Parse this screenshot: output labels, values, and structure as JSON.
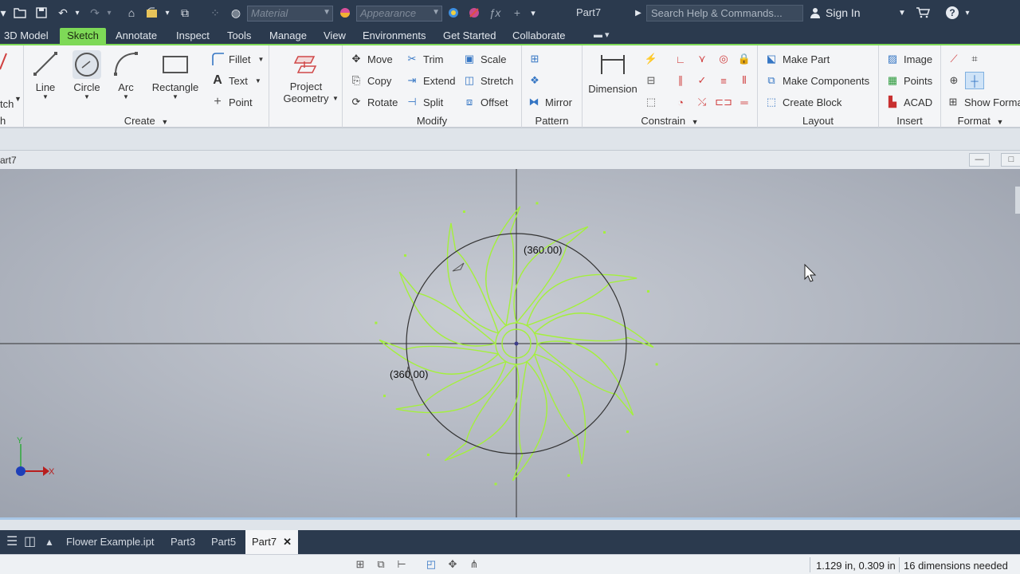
{
  "titlebar": {
    "material_placeholder": "Material",
    "appearance_placeholder": "Appearance",
    "document_title": "Part7",
    "search_placeholder": "Search Help & Commands...",
    "sign_in": "Sign In"
  },
  "tabs": [
    {
      "label": "3D Model"
    },
    {
      "label": "Sketch"
    },
    {
      "label": "Annotate"
    },
    {
      "label": "Inspect"
    },
    {
      "label": "Tools"
    },
    {
      "label": "Manage"
    },
    {
      "label": "View"
    },
    {
      "label": "Environments"
    },
    {
      "label": "Get Started"
    },
    {
      "label": "Collaborate"
    }
  ],
  "ribbon": {
    "cut_panel_label": "tch",
    "cut_panel_title": "h",
    "create": {
      "title": "Create",
      "line": "Line",
      "circle": "Circle",
      "arc": "Arc",
      "rectangle": "Rectangle",
      "fillet": "Fillet",
      "text": "Text",
      "point": "Point"
    },
    "project": {
      "line1": "Project",
      "line2": "Geometry"
    },
    "modify": {
      "title": "Modify",
      "move": "Move",
      "copy": "Copy",
      "rotate": "Rotate",
      "trim": "Trim",
      "extend": "Extend",
      "split": "Split",
      "scale": "Scale",
      "stretch": "Stretch",
      "offset": "Offset"
    },
    "pattern": {
      "title": "Pattern",
      "mirror": "Mirror"
    },
    "constrain": {
      "title": "Constrain",
      "dimension": "Dimension"
    },
    "layout": {
      "title": "Layout",
      "make_part": "Make Part",
      "make_components": "Make Components",
      "create_block": "Create Block"
    },
    "insert": {
      "title": "Insert",
      "image": "Image",
      "points": "Points",
      "acad": "ACAD"
    },
    "format": {
      "title": "Format",
      "show_format": "Show Format"
    }
  },
  "document": {
    "name": "art7"
  },
  "canvas": {
    "dimension_top": "(360.00)",
    "dimension_left": "(360.00)",
    "axis_y": "Y",
    "axis_x": "X"
  },
  "doc_tabs": [
    {
      "label": "Flower Example.ipt"
    },
    {
      "label": "Part3"
    },
    {
      "label": "Part5"
    },
    {
      "label": "Part7"
    }
  ],
  "status": {
    "coordinates": "1.129 in, 0.309 in",
    "dimensions_needed": "16 dimensions needed"
  },
  "colors": {
    "accent_green": "#7ed957",
    "sketch_green": "#a4f03c",
    "dark_bar": "#2b3a4e"
  }
}
